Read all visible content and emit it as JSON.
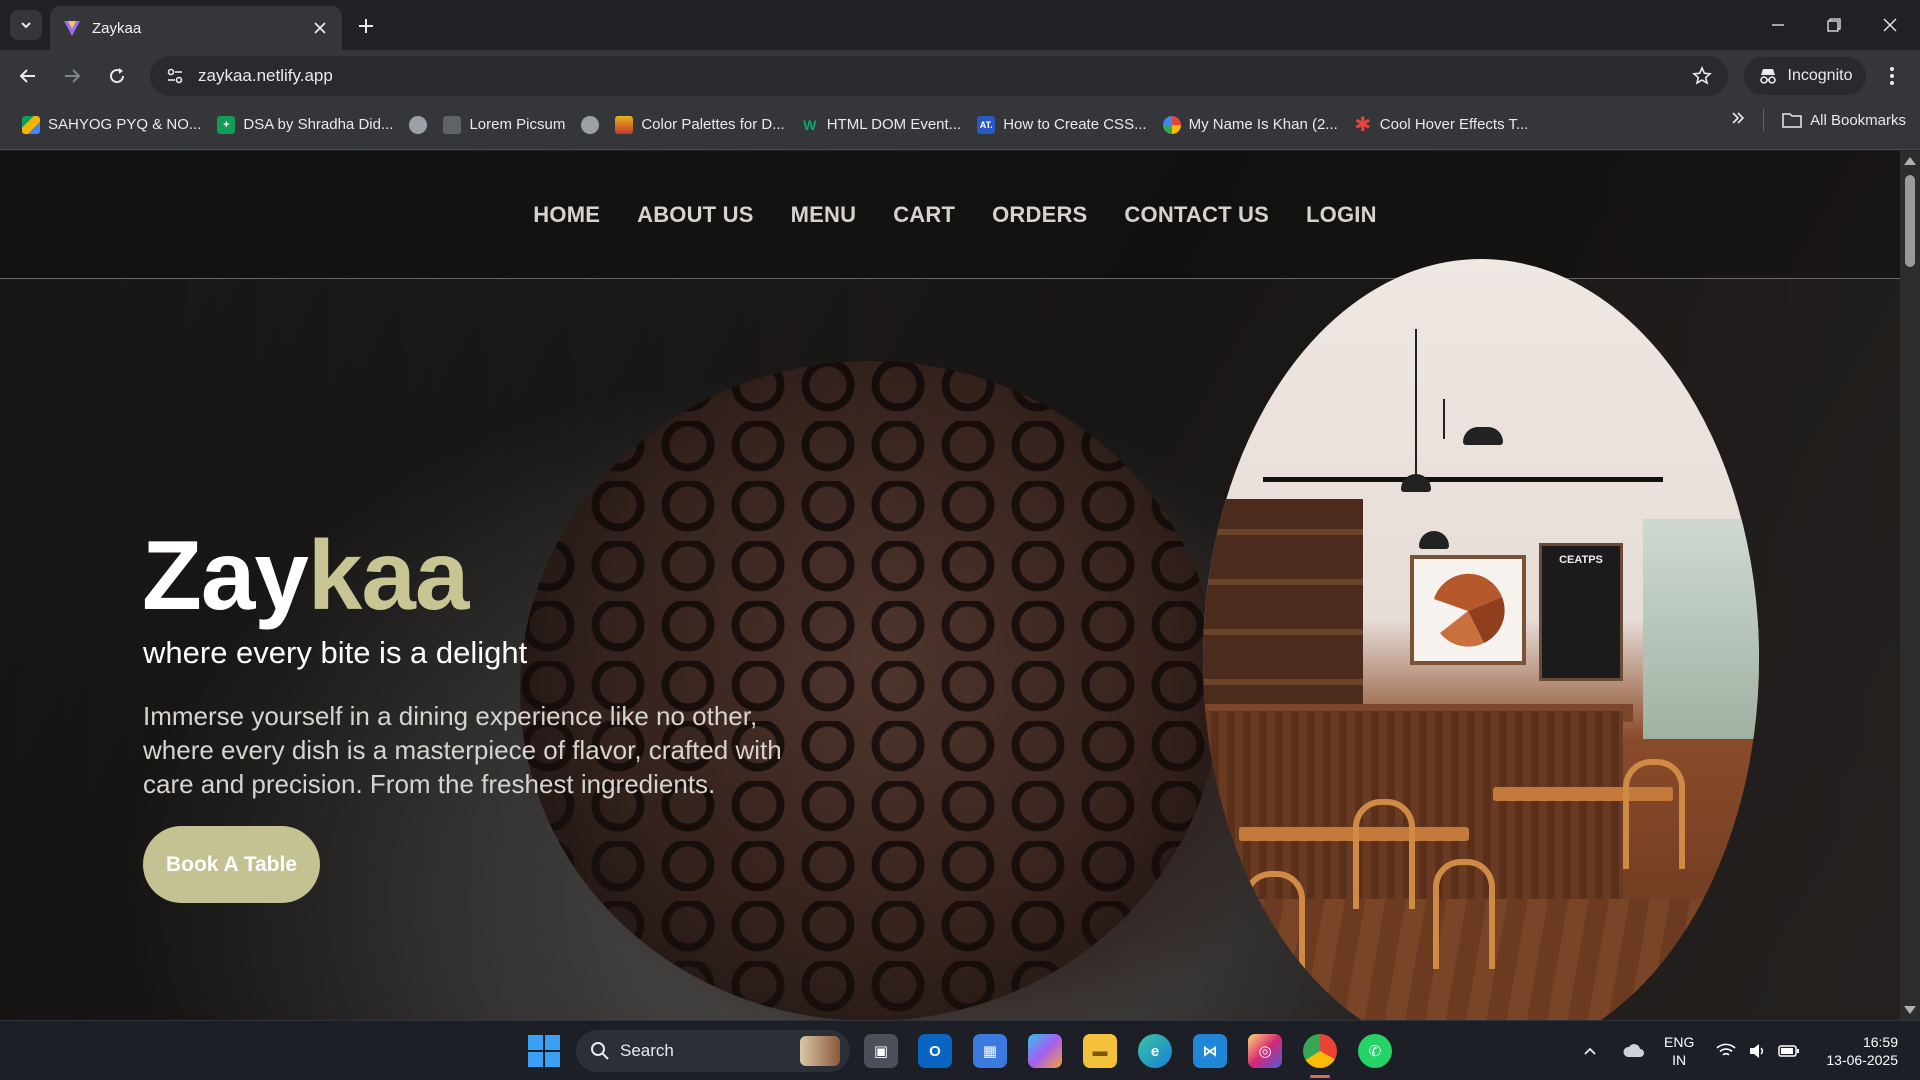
{
  "browser": {
    "tab": {
      "title": "Zaykaa"
    },
    "url": "zaykaa.netlify.app",
    "incognito_label": "Incognito",
    "bookmarks": [
      {
        "label": "SAHYOG PYQ & NO...",
        "icon": "drive-icon",
        "color": "#f4b400"
      },
      {
        "label": "DSA by Shradha Did...",
        "icon": "sheets-icon",
        "color": "#0f9d58"
      },
      {
        "label": "",
        "icon": "globe-icon",
        "color": "#9aa0a6"
      },
      {
        "label": "Lorem Picsum",
        "icon": "picsum-icon",
        "color": "#5f6368"
      },
      {
        "label": "",
        "icon": "globe-icon",
        "color": "#9aa0a6"
      },
      {
        "label": "Color Palettes for D...",
        "icon": "palette-icon",
        "color": "#e8b21a"
      },
      {
        "label": "HTML DOM Event...",
        "icon": "w3-icon",
        "color": "#04aa6d"
      },
      {
        "label": "How to Create CSS...",
        "icon": "atech-icon",
        "color": "#2b59c3"
      },
      {
        "label": "My Name Is Khan (2...",
        "icon": "google-icon",
        "color": "#ea4335"
      },
      {
        "label": "Cool Hover Effects T...",
        "icon": "asterisk-icon",
        "color": "#e8453c"
      }
    ],
    "all_bookmarks_label": "All Bookmarks"
  },
  "site": {
    "nav": [
      "HOME",
      "ABOUT US",
      "MENU",
      "CART",
      "ORDERS",
      "CONTACT US",
      "LOGIN"
    ],
    "brand_main": "Zay",
    "brand_accent": "kaa",
    "tagline": "where every bite is a delight",
    "description": "Immerse yourself in a dining experience like no other, where every dish is a masterpiece of flavor, crafted with care and precision. From the freshest ingredients.",
    "cta": "Book A Table",
    "board_title": "CEATPS",
    "colors": {
      "accent": "#c8c595",
      "button": "#c4c193"
    }
  },
  "taskbar": {
    "search_label": "Search",
    "apps": [
      "task-view-icon",
      "outlook-icon",
      "store-icon",
      "copilot-icon",
      "file-explorer-icon",
      "edge-icon",
      "vscode-icon",
      "instagram-icon",
      "chrome-icon",
      "whatsapp-icon"
    ],
    "lang_line1": "ENG",
    "lang_line2": "IN",
    "time": "16:59",
    "date": "13-06-2025"
  }
}
